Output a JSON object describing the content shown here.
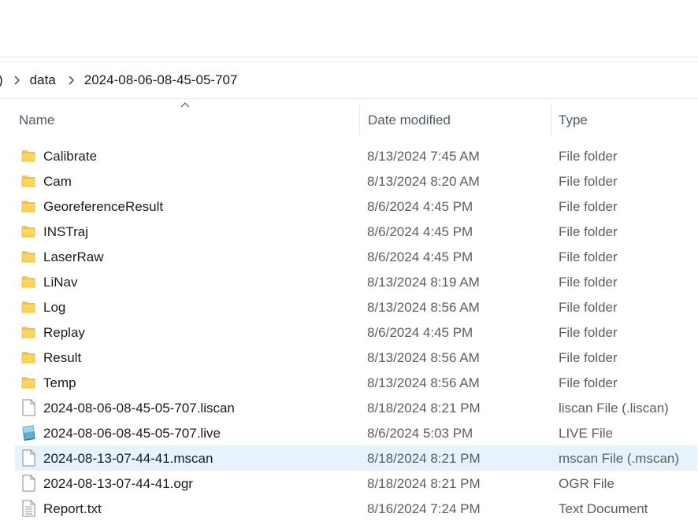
{
  "breadcrumb": {
    "fragment": ")",
    "items": [
      "data",
      "2024-08-06-08-45-05-707"
    ]
  },
  "columns": {
    "name": "Name",
    "date": "Date modified",
    "type": "Type"
  },
  "colors": {
    "folder": "#f8c93a",
    "selected_row": "#e5f3ff",
    "header_text": "#4c5a6b"
  },
  "files": [
    {
      "name": "Calibrate",
      "date": "8/13/2024 7:45 AM",
      "type": "File folder",
      "icon": "folder-icon"
    },
    {
      "name": "Cam",
      "date": "8/13/2024 8:20 AM",
      "type": "File folder",
      "icon": "folder-icon"
    },
    {
      "name": "GeoreferenceResult",
      "date": "8/6/2024 4:45 PM",
      "type": "File folder",
      "icon": "folder-icon"
    },
    {
      "name": "INSTraj",
      "date": "8/6/2024 4:45 PM",
      "type": "File folder",
      "icon": "folder-icon"
    },
    {
      "name": "LaserRaw",
      "date": "8/6/2024 4:45 PM",
      "type": "File folder",
      "icon": "folder-icon"
    },
    {
      "name": "LiNav",
      "date": "8/13/2024 8:19 AM",
      "type": "File folder",
      "icon": "folder-icon"
    },
    {
      "name": "Log",
      "date": "8/13/2024 8:56 AM",
      "type": "File folder",
      "icon": "folder-icon"
    },
    {
      "name": "Replay",
      "date": "8/6/2024 4:45 PM",
      "type": "File folder",
      "icon": "folder-icon"
    },
    {
      "name": "Result",
      "date": "8/13/2024 8:56 AM",
      "type": "File folder",
      "icon": "folder-icon"
    },
    {
      "name": "Temp",
      "date": "8/13/2024 8:56 AM",
      "type": "File folder",
      "icon": "folder-icon"
    },
    {
      "name": "2024-08-06-08-45-05-707.liscan",
      "date": "8/18/2024 8:21 PM",
      "type": "liscan File (.liscan)",
      "icon": "file-icon"
    },
    {
      "name": "2024-08-06-08-45-05-707.live",
      "date": "8/6/2024 5:03 PM",
      "type": "LIVE File",
      "icon": "live-file-icon"
    },
    {
      "name": "2024-08-13-07-44-41.mscan",
      "date": "8/18/2024 8:21 PM",
      "type": "mscan File (.mscan)",
      "icon": "file-icon",
      "selected": true
    },
    {
      "name": "2024-08-13-07-44-41.ogr",
      "date": "8/18/2024 8:21 PM",
      "type": "OGR File",
      "icon": "file-icon"
    },
    {
      "name": "Report.txt",
      "date": "8/16/2024 7:24 PM",
      "type": "Text Document",
      "icon": "text-file-icon"
    }
  ]
}
